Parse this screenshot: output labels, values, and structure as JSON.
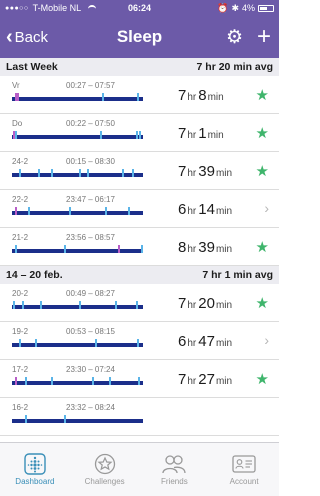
{
  "status_bar": {
    "carrier": "T-Mobile NL",
    "time": "06:24",
    "bluetooth": "✱",
    "battery": "4%"
  },
  "nav": {
    "back_label": "Back",
    "title": "Sleep"
  },
  "sections": [
    {
      "title": "Last Week",
      "avg": "7 hr 20 min avg",
      "rows": [
        {
          "date": "Vr",
          "range": "00:27 – 07:57",
          "hr": "7",
          "min": "8",
          "hr_unit": "hr",
          "min_unit": "min",
          "status": "star"
        },
        {
          "date": "Do",
          "range": "00:22 – 07:50",
          "hr": "7",
          "min": "1",
          "hr_unit": "hr",
          "min_unit": "min",
          "status": "star"
        },
        {
          "date": "24-2",
          "range": "00:15 – 08:30",
          "hr": "7",
          "min": "39",
          "hr_unit": "hr",
          "min_unit": "min",
          "status": "star"
        },
        {
          "date": "22-2",
          "range": "23:47 – 06:17",
          "hr": "6",
          "min": "14",
          "hr_unit": "hr",
          "min_unit": "min",
          "status": "chevron"
        },
        {
          "date": "21-2",
          "range": "23:56 – 08:57",
          "hr": "8",
          "min": "39",
          "hr_unit": "hr",
          "min_unit": "min",
          "status": "star"
        }
      ]
    },
    {
      "title": "14 – 20 feb.",
      "avg": "7 hr 1 min avg",
      "rows": [
        {
          "date": "20-2",
          "range": "00:49 – 08:27",
          "hr": "7",
          "min": "20",
          "hr_unit": "hr",
          "min_unit": "min",
          "status": "star"
        },
        {
          "date": "19-2",
          "range": "00:53 – 08:15",
          "hr": "6",
          "min": "47",
          "hr_unit": "hr",
          "min_unit": "min",
          "status": "chevron"
        },
        {
          "date": "17-2",
          "range": "23:30 – 07:24",
          "hr": "7",
          "min": "27",
          "hr_unit": "hr",
          "min_unit": "min",
          "status": "star"
        },
        {
          "date": "16-2",
          "range": "23:32 – 08:24",
          "hr": "",
          "min": "",
          "hr_unit": "",
          "min_unit": "",
          "status": ""
        }
      ]
    }
  ],
  "tabs": [
    {
      "label": "Dashboard",
      "icon": "dashboard-icon",
      "active": true
    },
    {
      "label": "Challenges",
      "icon": "star-badge-icon",
      "active": false
    },
    {
      "label": "Friends",
      "icon": "friends-icon",
      "active": false
    },
    {
      "label": "Account",
      "icon": "account-card-icon",
      "active": false
    }
  ],
  "colors": {
    "header_purple": "#6c5aa8",
    "bar_navy": "#1b2e8a",
    "awake_blue": "#5ab4e8",
    "restless_pink": "#b85ec8",
    "goal_star_green": "#3fb56c",
    "tab_active": "#3a8fb8"
  }
}
